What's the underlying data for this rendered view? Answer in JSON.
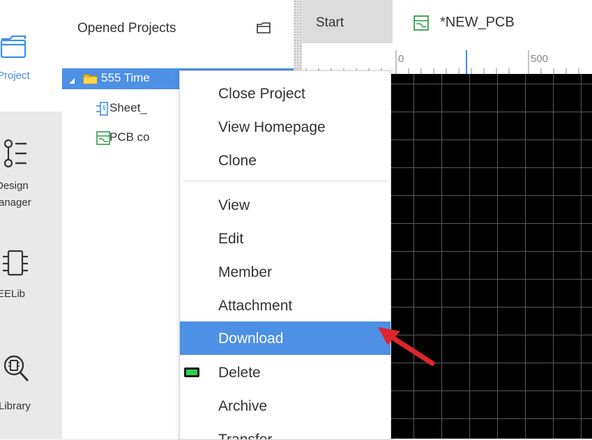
{
  "rail": {
    "items": [
      {
        "label": "Project"
      },
      {
        "label": "Design"
      },
      {
        "label": "Manager_display",
        "display": "anager"
      },
      {
        "label": "EELib"
      },
      {
        "label": "Library"
      }
    ],
    "project_label": "Project",
    "design_label_1": "Design",
    "design_label_2": "anager",
    "eelib_label": "EELib",
    "library_label": "Library"
  },
  "panel": {
    "title": "Opened Projects",
    "tree": {
      "project_name": "555 Time",
      "sheet_name": "Sheet_",
      "pcb_name": "PCB co"
    }
  },
  "tabs": [
    {
      "label": "Start"
    },
    {
      "label": "*NEW_PCB"
    }
  ],
  "ruler": {
    "labels": [
      "0",
      "500"
    ]
  },
  "context_menu": {
    "items": [
      {
        "label": "Close Project"
      },
      {
        "label": "View Homepage"
      },
      {
        "label": "Clone"
      },
      {
        "label": "View"
      },
      {
        "label": "Edit"
      },
      {
        "label": "Member"
      },
      {
        "label": "Attachment"
      },
      {
        "label": "Download"
      },
      {
        "label": "Delete"
      },
      {
        "label": "Archive"
      },
      {
        "label": "Transfer"
      }
    ],
    "highlighted": "Download"
  },
  "colors": {
    "accent": "#4d90e6",
    "canvas": "#000000",
    "grid": "#5a5a5a",
    "annotation_arrow": "#e0262d",
    "pcb_icon": "#2e9d4a",
    "folder": "#f2b705"
  },
  "icons": {
    "project": "project-folder-icon",
    "design_manager": "design-manager-icon",
    "eelib": "chip-icon",
    "library": "library-search-icon",
    "open_folder": "folder-open-icon",
    "pcb": "pcb-file-icon",
    "schematic": "schematic-sheet-icon",
    "delete_badge": "green-badge-icon"
  }
}
